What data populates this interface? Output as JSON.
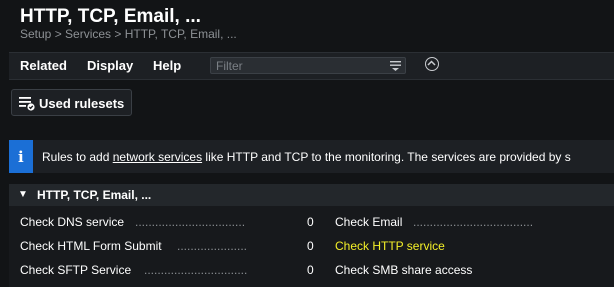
{
  "page": {
    "title": "HTTP, TCP, Email, ...",
    "breadcrumb": "Setup > Services > HTTP, TCP, Email, ..."
  },
  "menu": {
    "items": [
      "Related",
      "Display",
      "Help"
    ],
    "filter_placeholder": "Filter"
  },
  "toolbar": {
    "used_rulesets_label": "Used rulesets"
  },
  "info": {
    "icon": "i",
    "text_before": "Rules to add ",
    "link": "network services",
    "text_after": " like HTTP and TCP to the monitoring. The services are provided by s"
  },
  "section": {
    "title": "HTTP, TCP, Email, ...",
    "left": [
      {
        "name": "Check DNS service",
        "dots": ".................................",
        "count": "0"
      },
      {
        "name": "Check HTML Form Submit",
        "dots": ".....................",
        "count": "0"
      },
      {
        "name": "Check SFTP Service",
        "dots": "...............................",
        "count": "0"
      }
    ],
    "right": [
      {
        "name": "Check Email",
        "dots": "....................................",
        "count": ""
      },
      {
        "name": "Check HTTP service",
        "dots": "",
        "count": ""
      },
      {
        "name": "Check SMB share access",
        "dots": "",
        "count": ""
      }
    ]
  },
  "colors": {
    "background": "#121416",
    "info_accent": "#1b6fd6",
    "highlight": "#f4f028"
  }
}
